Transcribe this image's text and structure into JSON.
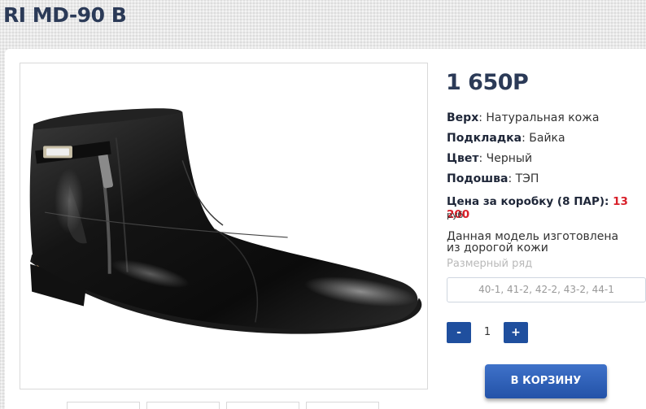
{
  "product": {
    "title": "RI MD-90 B",
    "price": "1 650Р"
  },
  "specs": [
    {
      "label": "Верх",
      "value": ": Натуральная кожа"
    },
    {
      "label": "Подкладка",
      "value": ": Байка"
    },
    {
      "label": "Цвет",
      "value": ": Черный"
    },
    {
      "label": "Подошва",
      "value": ": ТЭП"
    }
  ],
  "box": {
    "label": "Цена за коробку (8 ПАР): ",
    "value": "13 200",
    "unit": "руб"
  },
  "description": "Данная модель изготовлена из дорогой кожи",
  "sizes": {
    "label": "Размерный ряд",
    "value": "40-1, 41-2, 42-2, 43-2, 44-1"
  },
  "quantity": {
    "minus": "-",
    "value": "1",
    "plus": "+"
  },
  "cart_button": "В КОРЗИНУ",
  "colors": {
    "accent": "#1f4f9e",
    "title": "#2b3a57",
    "price_red": "#d8202a"
  }
}
